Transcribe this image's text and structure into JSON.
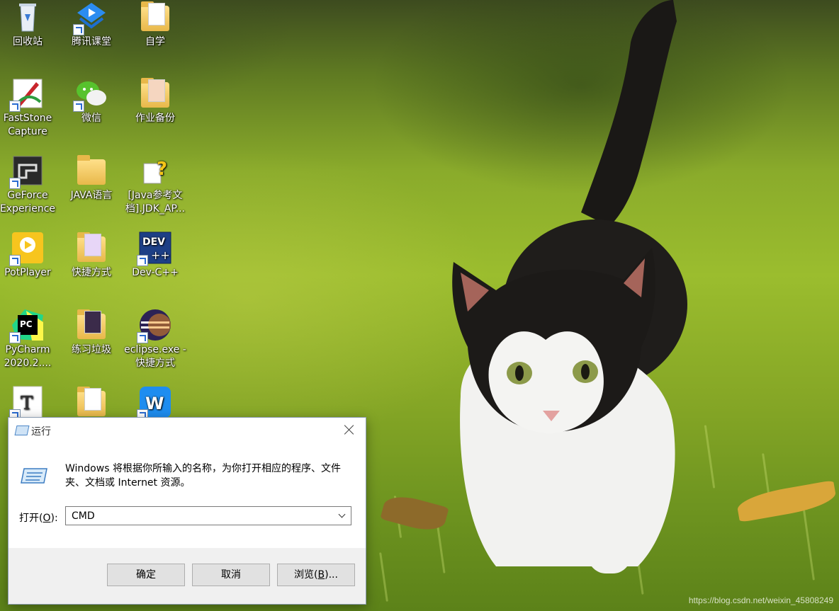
{
  "desktop": {
    "icons": [
      {
        "label": "回收站",
        "icon": "recycle-bin-icon"
      },
      {
        "label": "腾讯课堂",
        "icon": "tencent-classroom-icon"
      },
      {
        "label": "自学",
        "icon": "folder-icon"
      },
      {
        "label": "FastStone Capture",
        "icon": "faststone-capture-icon"
      },
      {
        "label": "微信",
        "icon": "wechat-icon"
      },
      {
        "label": "作业备份",
        "icon": "folder-icon"
      },
      {
        "label": "GeForce Experience",
        "icon": "geforce-experience-icon"
      },
      {
        "label": "JAVA语言",
        "icon": "folder-icon"
      },
      {
        "label": "[Java参考文档].JDK_AP...",
        "icon": "help-document-icon"
      },
      {
        "label": "PotPlayer",
        "icon": "potplayer-icon"
      },
      {
        "label": "快捷方式",
        "icon": "folder-icon"
      },
      {
        "label": "Dev-C++",
        "icon": "dev-cpp-icon"
      },
      {
        "label": "PyCharm 2020.2....",
        "icon": "pycharm-icon"
      },
      {
        "label": "练习垃圾",
        "icon": "folder-icon"
      },
      {
        "label": "eclipse.exe - 快捷方式",
        "icon": "eclipse-icon"
      },
      {
        "label": "",
        "icon": "typora-icon"
      },
      {
        "label": "",
        "icon": "folder-icon"
      },
      {
        "label": "",
        "icon": "wps-office-icon"
      }
    ]
  },
  "run_dialog": {
    "title": "运行",
    "description": "Windows 将根据你所输入的名称，为你打开相应的程序、文件夹、文档或 Internet 资源。",
    "open_label_prefix": "打开(",
    "open_label_accel": "O",
    "open_label_suffix": "):",
    "open_value": "CMD",
    "ok_label": "确定",
    "cancel_label": "取消",
    "browse_label_prefix": "浏览(",
    "browse_label_accel": "B",
    "browse_label_suffix": ")..."
  },
  "watermark": "https://blog.csdn.net/weixin_45808249",
  "colors": {
    "dialog_footer": "#f0f0f0",
    "button_face": "#e1e1e1",
    "grass": "#8aab2b"
  }
}
